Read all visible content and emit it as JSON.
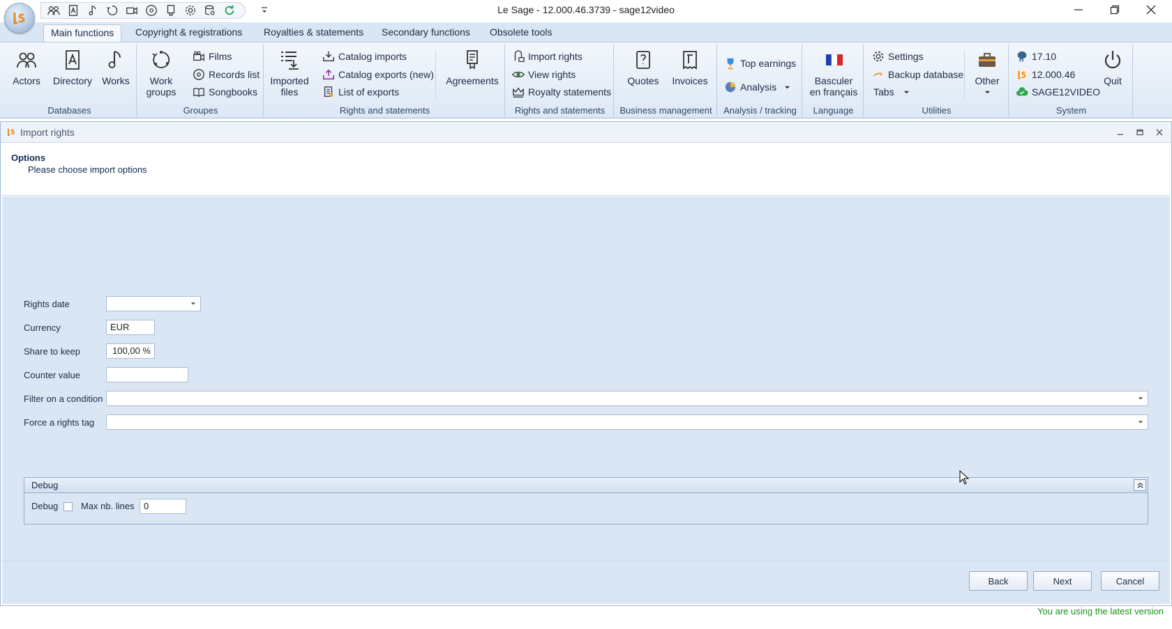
{
  "window": {
    "title": "Le Sage - 12.000.46.3739 - sage12video"
  },
  "ribbon": {
    "tabs": [
      {
        "label": "Main functions",
        "active": true
      },
      {
        "label": "Copyright & registrations"
      },
      {
        "label": "Royalties & statements"
      },
      {
        "label": "Secondary functions"
      },
      {
        "label": "Obsolete tools"
      }
    ],
    "groups": {
      "databases": {
        "label": "Databases",
        "actors": "Actors",
        "directory": "Directory",
        "works": "Works"
      },
      "groupes": {
        "label": "Groupes",
        "work_groups_1": "Work",
        "work_groups_2": "groups",
        "films": "Films",
        "records_list": "Records list",
        "songbooks": "Songbooks"
      },
      "rights1": {
        "label": "Rights and statements",
        "imported_files_1": "Imported",
        "imported_files_2": "files",
        "catalog_imports": "Catalog imports",
        "catalog_exports": "Catalog exports (new)",
        "list_of_exports": "List of exports",
        "agreements": "Agreements"
      },
      "rights2": {
        "label": "Rights and statements",
        "import_rights": "Import rights",
        "view_rights": "View rights",
        "royalty_statements": "Royalty statements"
      },
      "business": {
        "label": "Business management",
        "quotes": "Quotes",
        "invoices": "Invoices"
      },
      "analysis": {
        "label": "Analysis / tracking",
        "top_earnings": "Top earnings",
        "analysis": "Analysis"
      },
      "language": {
        "label": "Language",
        "switch_1": "Basculer",
        "switch_2": "en français"
      },
      "utilities": {
        "label": "Utilities",
        "settings": "Settings",
        "backup": "Backup database",
        "tabs": "Tabs",
        "other": "Other"
      },
      "system": {
        "label": "System",
        "pg_version": "17.10",
        "app_version": "12.000.46",
        "db_name": "SAGE12VIDEO",
        "quit": "Quit"
      }
    }
  },
  "child": {
    "title": "Import rights",
    "header": {
      "title": "Options",
      "subtitle": "Please choose import options"
    },
    "form": {
      "rights_date": {
        "label": "Rights date",
        "value": ""
      },
      "currency": {
        "label": "Currency",
        "value": "EUR"
      },
      "share_to_keep": {
        "label": "Share to keep",
        "value": "100,00 %"
      },
      "counter_value": {
        "label": "Counter value",
        "value": ""
      },
      "filter_condition": {
        "label": "Filter on a condition",
        "value": ""
      },
      "force_tag": {
        "label": "Force a rights tag",
        "value": ""
      }
    },
    "debug": {
      "title": "Debug",
      "debug_label": "Debug",
      "debug_checked": false,
      "max_lines_label": "Max nb. lines",
      "max_lines_value": "0"
    },
    "buttons": {
      "back": "Back",
      "next": "Next",
      "cancel": "Cancel"
    }
  },
  "status": {
    "message": "You are using the latest version"
  },
  "colors": {
    "accent": "#dbe6f4",
    "status_green": "#1a8f1a",
    "brand_orange": "#e8891c"
  }
}
